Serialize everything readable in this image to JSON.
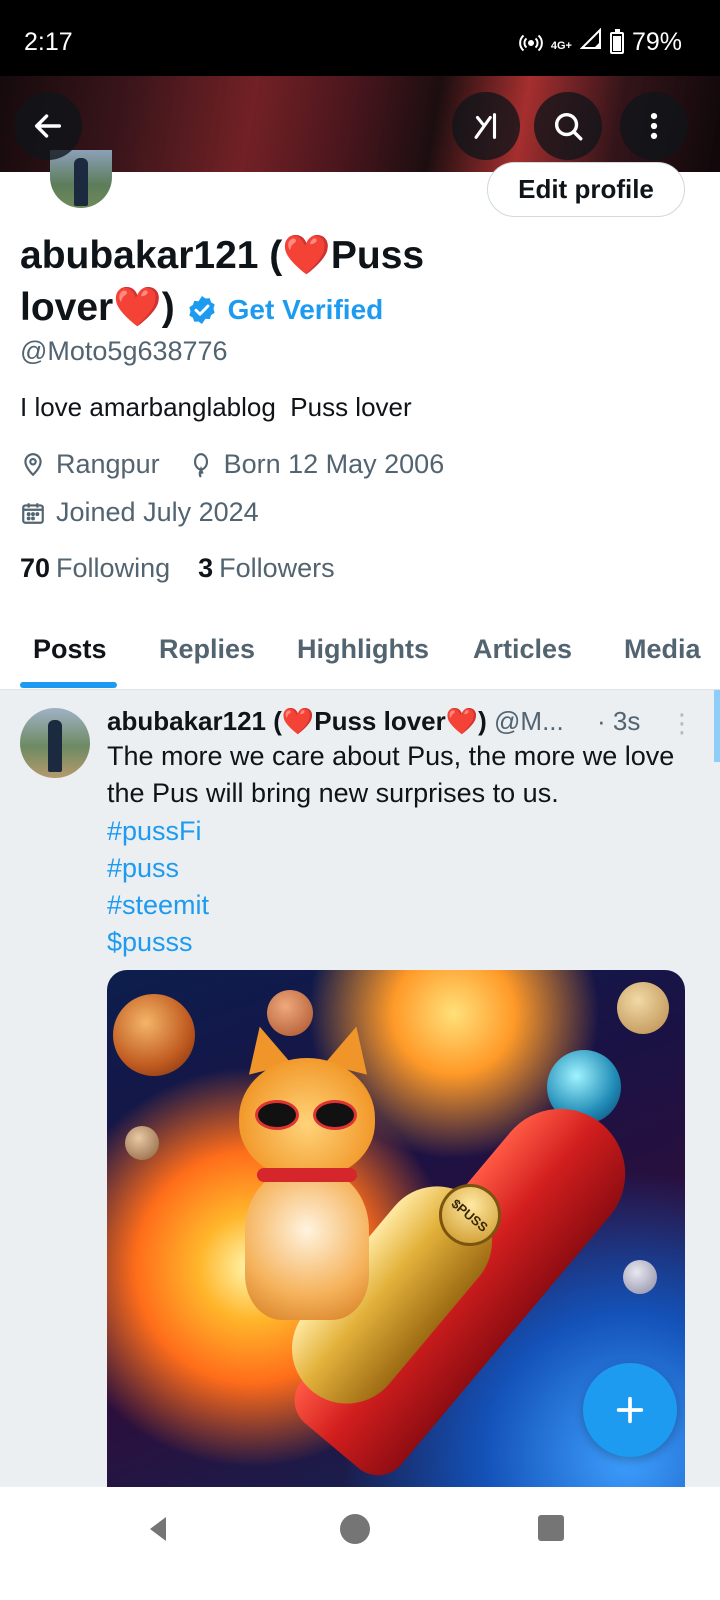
{
  "status_bar": {
    "time": "2:17",
    "network": "4G+",
    "battery": "79%"
  },
  "header": {
    "back_icon": "arrow-left-icon",
    "grok_icon": "grok-icon",
    "search_icon": "search-icon",
    "more_icon": "more-vertical-icon"
  },
  "profile": {
    "edit_label": "Edit profile",
    "name_part1": "abubakar121 (",
    "heart": "❤️",
    "name_part2": "Puss",
    "name_part3": "lover",
    "name_part4": ")",
    "get_verified": "Get Verified",
    "handle": "@Moto5g638776",
    "bio": "I love amarbanglablog  Puss lover",
    "location": "Rangpur",
    "birthday": "Born 12 May 2006",
    "joined": "Joined July 2024",
    "following_count": "70",
    "following_label": "Following",
    "followers_count": "3",
    "followers_label": "Followers"
  },
  "tabs": [
    {
      "label": "Posts",
      "active": true
    },
    {
      "label": "Replies",
      "active": false
    },
    {
      "label": "Highlights",
      "active": false
    },
    {
      "label": "Articles",
      "active": false
    },
    {
      "label": "Media",
      "active": false
    }
  ],
  "post": {
    "author": "abubakar121 (❤️Puss lover❤️)",
    "handle": "@M...",
    "time": "· 3s",
    "text": "The more we care about Pus, the more we love the Pus will bring new surprises to us.",
    "hashtags": [
      "#pussFi",
      "#puss",
      "#steemit",
      "$pusss"
    ],
    "media_label": "$PUSS"
  },
  "colors": {
    "accent": "#1d9bf0",
    "text_primary": "#0f1419",
    "text_secondary": "#536471",
    "post_bg": "#eceff2"
  }
}
